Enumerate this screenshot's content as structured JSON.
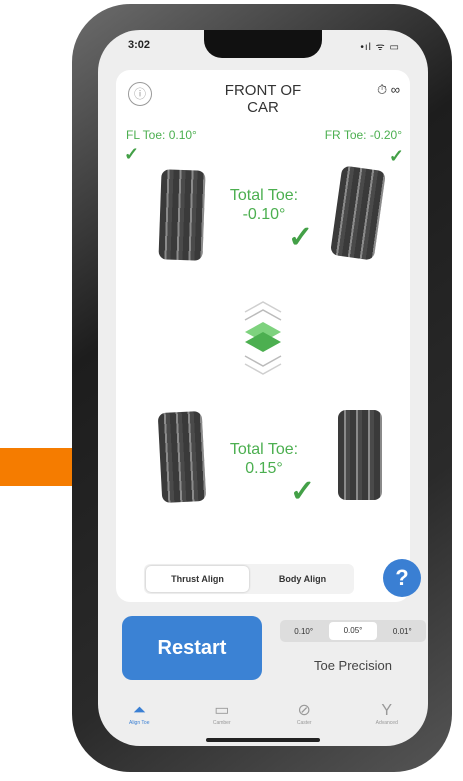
{
  "status_bar": {
    "time": "3:02",
    "icons": "•ıl ᯤ ▭"
  },
  "header": {
    "title": "FRONT OF CAR",
    "timer": "⏱ ∞"
  },
  "front": {
    "fl_toe": "FL Toe: 0.10°",
    "fr_toe": "FR Toe: -0.20°",
    "total_label": "Total Toe:",
    "total_value": "-0.10°"
  },
  "rear": {
    "total_label": "Total Toe:",
    "total_value": "0.15°"
  },
  "align_mode": {
    "options": [
      "Thrust Align",
      "Body Align"
    ],
    "selected": "Thrust Align"
  },
  "help_label": "?",
  "restart_label": "Restart",
  "precision": {
    "options": [
      "0.10°",
      "0.05°",
      "0.01°"
    ],
    "selected": "0.05°",
    "label": "Toe Precision"
  },
  "tabs": [
    {
      "label": "Align Toe",
      "icon": "align-toe-icon",
      "active": true
    },
    {
      "label": "Camber",
      "icon": "camber-icon",
      "active": false
    },
    {
      "label": "Caster",
      "icon": "caster-icon",
      "active": false
    },
    {
      "label": "Advanced",
      "icon": "advanced-icon",
      "active": false
    }
  ],
  "colors": {
    "accent": "#3a7fd3",
    "ok_green": "#4caf50",
    "arrow_orange": "#f57c00"
  }
}
